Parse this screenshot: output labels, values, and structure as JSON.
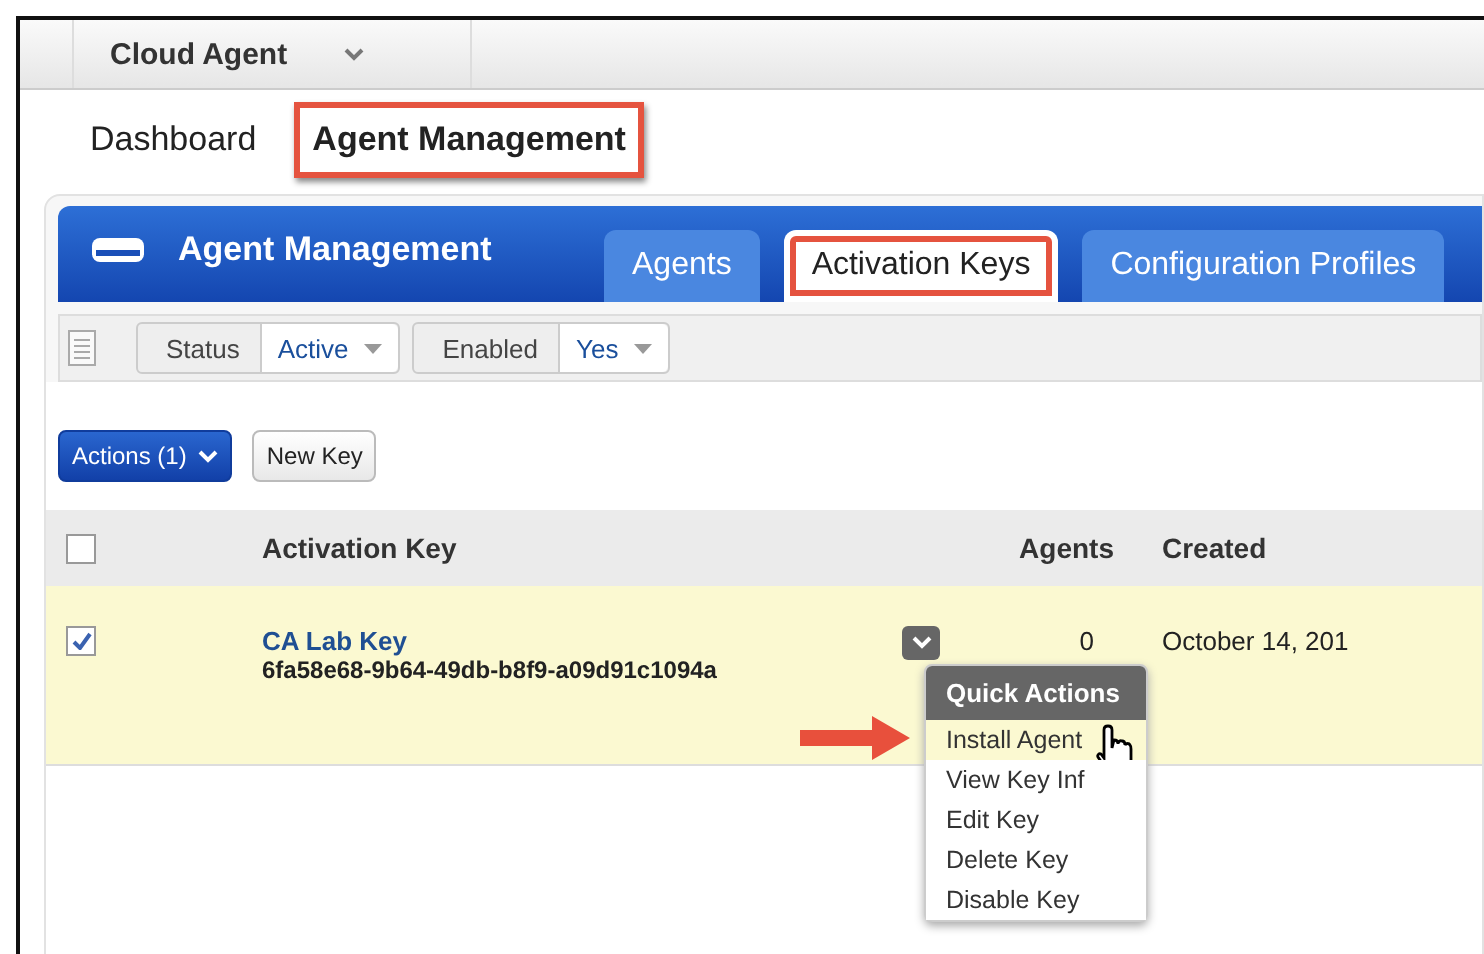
{
  "app_switcher": {
    "label": "Cloud Agent"
  },
  "nav": [
    {
      "label": "Dashboard",
      "selected": false,
      "highlighted": false
    },
    {
      "label": "Agent Management",
      "selected": true,
      "highlighted": true
    }
  ],
  "panel": {
    "title": "Agent Management",
    "tabs": [
      {
        "label": "Agents",
        "selected": false,
        "highlighted": false
      },
      {
        "label": "Activation Keys",
        "selected": true,
        "highlighted": true
      },
      {
        "label": "Configuration Profiles",
        "selected": false,
        "highlighted": false
      }
    ],
    "filters": [
      {
        "label": "Status",
        "value": "Active"
      },
      {
        "label": "Enabled",
        "value": "Yes"
      }
    ],
    "actions_button": "Actions (1)",
    "new_button": "New Key",
    "table": {
      "columns": [
        "Activation Key",
        "Agents",
        "Created"
      ],
      "header_checked": false,
      "rows": [
        {
          "checked": true,
          "name": "CA Lab Key",
          "key": "6fa58e68-9b64-49db-b8f9-a09d91c1094a",
          "agents": "0",
          "created": "October 14, 201",
          "menu": {
            "title": "Quick Actions",
            "items": [
              {
                "label": "Install Agent",
                "hovered": true
              },
              {
                "label": "View Key Inf",
                "hovered": false
              },
              {
                "label": "Edit Key",
                "hovered": false
              },
              {
                "label": "Delete Key",
                "hovered": false
              },
              {
                "label": "Disable Key",
                "hovered": false
              }
            ]
          }
        }
      ]
    }
  }
}
